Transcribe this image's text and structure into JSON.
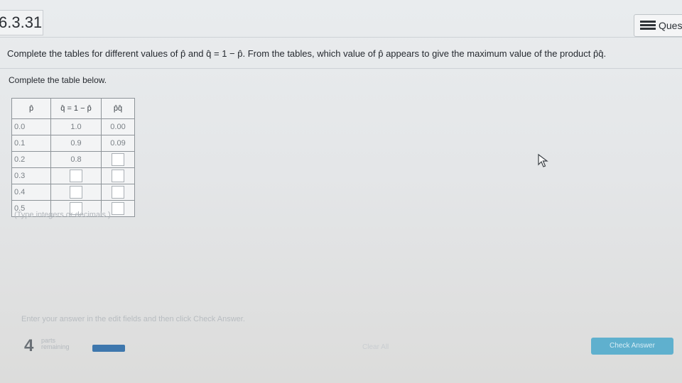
{
  "header": {
    "problem_id": "6.3.31",
    "question_menu_label": "Ques"
  },
  "question": {
    "text": "Complete the tables for different values of p̂ and q̂ = 1 − p̂. From the tables, which value of p̂ appears to give the maximum value of the product p̂q̂."
  },
  "instruction": "Complete the table below.",
  "table": {
    "headers": [
      "p̂",
      "q̂ = 1 − p̂",
      "p̂q̂"
    ],
    "rows": [
      {
        "p": "0.0",
        "q": "1.0",
        "pq": "0.00"
      },
      {
        "p": "0.1",
        "q": "0.9",
        "pq": "0.09"
      },
      {
        "p": "0.2",
        "q": "0.8",
        "pq": ""
      },
      {
        "p": "0.3",
        "q": "",
        "pq": ""
      },
      {
        "p": "0.4",
        "q": "",
        "pq": ""
      },
      {
        "p": "0.5",
        "q": "",
        "pq": ""
      }
    ],
    "hint": "(Type integers or decimals.)"
  },
  "footer": {
    "hint": "Enter your answer in the edit fields and then click Check Answer.",
    "parts_count": "4",
    "parts_label_1": "parts",
    "parts_label_2": "remaining",
    "clear_all": "Clear All",
    "check_answer": "Check Answer"
  },
  "colors": {
    "accent": "#3e77ad",
    "check_button": "#5fb0ce"
  }
}
